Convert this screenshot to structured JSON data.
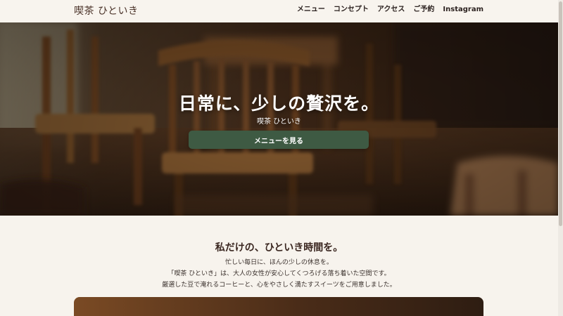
{
  "header": {
    "logo": "喫茶 ひといき",
    "nav": [
      {
        "label": "メニュー"
      },
      {
        "label": "コンセプト"
      },
      {
        "label": "アクセス"
      },
      {
        "label": "ご予約"
      },
      {
        "label": "Instagram"
      }
    ]
  },
  "hero": {
    "title": "日常に、少しの贅沢を。",
    "subtitle": "喫茶 ひといき",
    "button_label": "メニューを見る"
  },
  "intro": {
    "title": "私だけの、ひといき時間を。",
    "lines": [
      "忙しい毎日に、ほんの少しの休息を。",
      "「喫茶 ひといき」は、大人の女性が安心してくつろげる落ち着いた空間です。",
      "厳選した豆で淹れるコーヒーと、心をやさしく満たすスイーツをご用意しました。"
    ]
  }
}
